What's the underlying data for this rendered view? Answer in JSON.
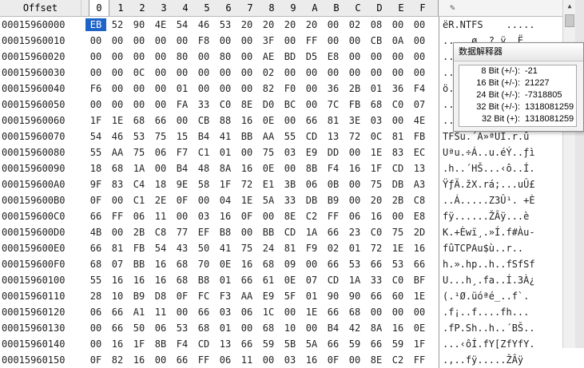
{
  "header": {
    "offset_label": "Offset",
    "columns": [
      "0",
      "1",
      "2",
      "3",
      "4",
      "5",
      "6",
      "7",
      "8",
      "9",
      "A",
      "B",
      "C",
      "D",
      "E",
      "F"
    ],
    "edit_icon": "pencil-icon"
  },
  "rows": [
    {
      "offset": "00015960000",
      "hex": [
        "EB",
        "52",
        "90",
        "4E",
        "54",
        "46",
        "53",
        "20",
        "20",
        "20",
        "20",
        "00",
        "02",
        "08",
        "00",
        "00"
      ],
      "ascii": "ëR.NTFS    ....."
    },
    {
      "offset": "00015960010",
      "hex": [
        "00",
        "00",
        "00",
        "00",
        "00",
        "F8",
        "00",
        "00",
        "3F",
        "00",
        "FF",
        "00",
        "00",
        "CB",
        "0A",
        "00"
      ],
      "ascii": ".....ø..?.ÿ..Ë.."
    },
    {
      "offset": "00015960020",
      "hex": [
        "00",
        "00",
        "00",
        "00",
        "80",
        "00",
        "80",
        "00",
        "AE",
        "BD",
        "D5",
        "E8",
        "00",
        "00",
        "00",
        "00"
      ],
      "ascii": "....€.€.®½Õè...."
    },
    {
      "offset": "00015960030",
      "hex": [
        "00",
        "00",
        "0C",
        "00",
        "00",
        "00",
        "00",
        "00",
        "02",
        "00",
        "00",
        "00",
        "00",
        "00",
        "00",
        "00"
      ],
      "ascii": "................"
    },
    {
      "offset": "00015960040",
      "hex": [
        "F6",
        "00",
        "00",
        "00",
        "01",
        "00",
        "00",
        "00",
        "82",
        "F0",
        "00",
        "36",
        "2B",
        "01",
        "36",
        "F4"
      ],
      "ascii": "ö.......‚ð.6+.6ô"
    },
    {
      "offset": "00015960050",
      "hex": [
        "00",
        "00",
        "00",
        "00",
        "FA",
        "33",
        "C0",
        "8E",
        "D0",
        "BC",
        "00",
        "7C",
        "FB",
        "68",
        "C0",
        "07"
      ],
      "ascii": "....ú3ÀŽÐ¼.|ûhÀ."
    },
    {
      "offset": "00015960060",
      "hex": [
        "1F",
        "1E",
        "68",
        "66",
        "00",
        "CB",
        "88",
        "16",
        "0E",
        "00",
        "66",
        "81",
        "3E",
        "03",
        "00",
        "4E"
      ],
      "ascii": "..hf.Ëˆ...f>..N"
    },
    {
      "offset": "00015960070",
      "hex": [
        "54",
        "46",
        "53",
        "75",
        "15",
        "B4",
        "41",
        "BB",
        "AA",
        "55",
        "CD",
        "13",
        "72",
        "0C",
        "81",
        "FB"
      ],
      "ascii": "TFSu.´A»ªUÍ.r.û"
    },
    {
      "offset": "00015960080",
      "hex": [
        "55",
        "AA",
        "75",
        "06",
        "F7",
        "C1",
        "01",
        "00",
        "75",
        "03",
        "E9",
        "DD",
        "00",
        "1E",
        "83",
        "EC"
      ],
      "ascii": "Uªu.÷Á..u.éÝ..ƒì"
    },
    {
      "offset": "00015960090",
      "hex": [
        "18",
        "68",
        "1A",
        "00",
        "B4",
        "48",
        "8A",
        "16",
        "0E",
        "00",
        "8B",
        "F4",
        "16",
        "1F",
        "CD",
        "13"
      ],
      "ascii": ".h..´HŠ...‹ô..Í."
    },
    {
      "offset": "000159600A0",
      "hex": [
        "9F",
        "83",
        "C4",
        "18",
        "9E",
        "58",
        "1F",
        "72",
        "E1",
        "3B",
        "06",
        "0B",
        "00",
        "75",
        "DB",
        "A3"
      ],
      "ascii": "ŸƒÄ.žX.rá;...uÛ£"
    },
    {
      "offset": "000159600B0",
      "hex": [
        "0F",
        "00",
        "C1",
        "2E",
        "0F",
        "00",
        "04",
        "1E",
        "5A",
        "33",
        "DB",
        "B9",
        "00",
        "20",
        "2B",
        "C8"
      ],
      "ascii": "..Á.....Z3Û¹. +È"
    },
    {
      "offset": "000159600C0",
      "hex": [
        "66",
        "FF",
        "06",
        "11",
        "00",
        "03",
        "16",
        "0F",
        "00",
        "8E",
        "C2",
        "FF",
        "06",
        "16",
        "00",
        "E8"
      ],
      "ascii": "fÿ......ŽÂÿ...è"
    },
    {
      "offset": "000159600D0",
      "hex": [
        "4B",
        "00",
        "2B",
        "C8",
        "77",
        "EF",
        "B8",
        "00",
        "BB",
        "CD",
        "1A",
        "66",
        "23",
        "C0",
        "75",
        "2D"
      ],
      "ascii": "K.+Èwï¸.»Í.f#Àu-"
    },
    {
      "offset": "000159600E0",
      "hex": [
        "66",
        "81",
        "FB",
        "54",
        "43",
        "50",
        "41",
        "75",
        "24",
        "81",
        "F9",
        "02",
        "01",
        "72",
        "1E",
        "16"
      ],
      "ascii": "fûTCPAu$ù..r.."
    },
    {
      "offset": "000159600F0",
      "hex": [
        "68",
        "07",
        "BB",
        "16",
        "68",
        "70",
        "0E",
        "16",
        "68",
        "09",
        "00",
        "66",
        "53",
        "66",
        "53",
        "66"
      ],
      "ascii": "h.».hp..h..fSfSf"
    },
    {
      "offset": "00015960100",
      "hex": [
        "55",
        "16",
        "16",
        "16",
        "68",
        "B8",
        "01",
        "66",
        "61",
        "0E",
        "07",
        "CD",
        "1A",
        "33",
        "C0",
        "BF"
      ],
      "ascii": "U...h¸.fa..Í.3À¿"
    },
    {
      "offset": "00015960110",
      "hex": [
        "28",
        "10",
        "B9",
        "D8",
        "0F",
        "FC",
        "F3",
        "AA",
        "E9",
        "5F",
        "01",
        "90",
        "90",
        "66",
        "60",
        "1E"
      ],
      "ascii": "(.¹Ø.üóªé_..f`."
    },
    {
      "offset": "00015960120",
      "hex": [
        "06",
        "66",
        "A1",
        "11",
        "00",
        "66",
        "03",
        "06",
        "1C",
        "00",
        "1E",
        "66",
        "68",
        "00",
        "00",
        "00"
      ],
      "ascii": ".f¡..f....fh..."
    },
    {
      "offset": "00015960130",
      "hex": [
        "00",
        "66",
        "50",
        "06",
        "53",
        "68",
        "01",
        "00",
        "68",
        "10",
        "00",
        "B4",
        "42",
        "8A",
        "16",
        "0E"
      ],
      "ascii": ".fP.Sh..h..´BŠ.."
    },
    {
      "offset": "00015960140",
      "hex": [
        "00",
        "16",
        "1F",
        "8B",
        "F4",
        "CD",
        "13",
        "66",
        "59",
        "5B",
        "5A",
        "66",
        "59",
        "66",
        "59",
        "1F"
      ],
      "ascii": "...‹ôÍ.fY[ZfYfY."
    },
    {
      "offset": "00015960150",
      "hex": [
        "0F",
        "82",
        "16",
        "00",
        "66",
        "FF",
        "06",
        "11",
        "00",
        "03",
        "16",
        "0F",
        "00",
        "8E",
        "C2",
        "FF"
      ],
      "ascii": ".‚..fÿ.....ŽÂÿ"
    }
  ],
  "cursor": {
    "row": 0,
    "col": 0
  },
  "interpreter": {
    "title": "数据解释器",
    "fields": [
      {
        "label": "8 Bit (+/-):",
        "value": "-21"
      },
      {
        "label": "16 Bit (+/-):",
        "value": "21227"
      },
      {
        "label": "24 Bit (+/-):",
        "value": "-7318805"
      },
      {
        "label": "32 Bit (+/-):",
        "value": "1318081259"
      },
      {
        "label": "32 Bit (+):",
        "value": "1318081259"
      }
    ]
  },
  "scrollbar": {
    "up_icon": "arrow-up-icon"
  },
  "colors": {
    "cursor_bg": "#1e64c8",
    "header_bg": "#ececec",
    "popup_bg": "#f2f2f2"
  }
}
